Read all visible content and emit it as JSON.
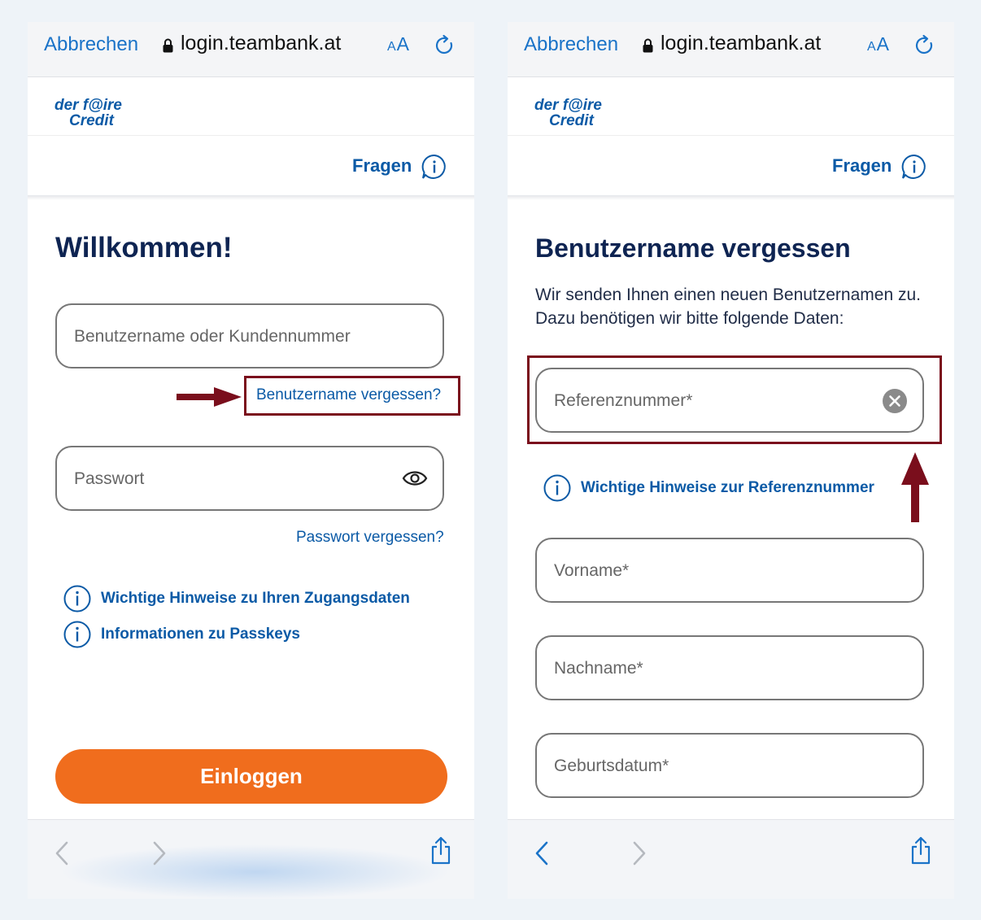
{
  "browser": {
    "cancel_label": "Abbrechen",
    "url": "login.teambank.at",
    "text_size_label": "AA"
  },
  "brand": {
    "logo_line1": "der faire",
    "logo_line2": "Credit"
  },
  "header": {
    "help_label": "Fragen"
  },
  "login_screen": {
    "title": "Willkommen!",
    "username_placeholder": "Benutzername oder Kundennummer",
    "forgot_username_link": "Benutzername vergessen?",
    "password_placeholder": "Passwort",
    "forgot_password_link": "Passwort vergessen?",
    "info_links": [
      "Wichtige Hinweise zu Ihren Zugangsdaten",
      "Informationen zu Passkeys"
    ],
    "login_button": "Einloggen"
  },
  "forgot_screen": {
    "title": "Benutzername vergessen",
    "description": "Wir senden Ihnen einen neuen Benutzernamen zu. Dazu benötigen wir bitte folgende Daten:",
    "reference_placeholder": "Referenznummer*",
    "reference_info_link": "Wichtige Hinweise zur Referenznummer",
    "firstname_placeholder": "Vorname*",
    "lastname_placeholder": "Nachname*",
    "birthdate_placeholder": "Geburtsdatum*"
  },
  "colors": {
    "brand_blue": "#0b5aa6",
    "safari_blue": "#1a73c8",
    "primary_orange": "#f06d1d",
    "annotation_red": "#7a0e1c",
    "heading_navy": "#0e2452"
  },
  "icons": [
    "lock-icon",
    "text-size-icon",
    "reload-icon",
    "help-info-icon",
    "eye-icon",
    "info-icon",
    "clear-icon",
    "back-arrow-icon",
    "forward-arrow-icon",
    "share-icon",
    "annotation-arrow-icon"
  ]
}
